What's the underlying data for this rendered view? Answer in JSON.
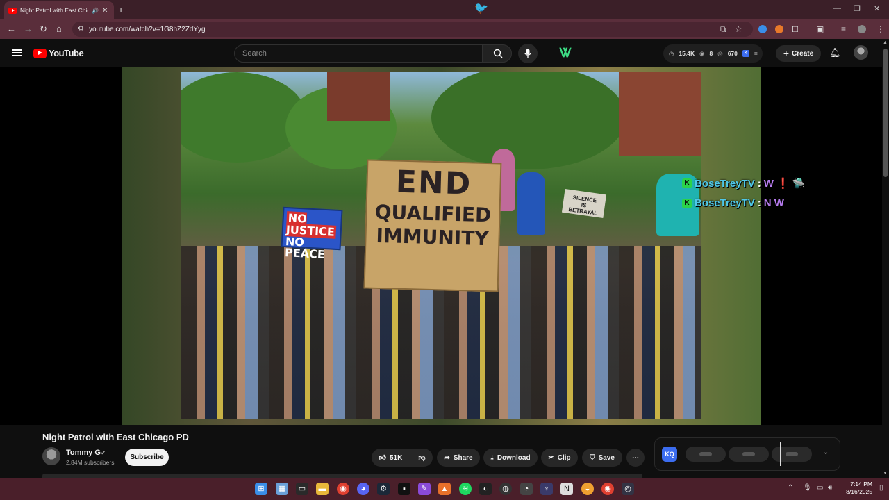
{
  "browser": {
    "tab_title": "Night Patrol with East Chicag",
    "url": "youtube.com/watch?v=1G8hZ2ZdYyg",
    "new_tab_glyph": "+",
    "tab_close_glyph": "✕",
    "audio_glyph": "🔊"
  },
  "youtube": {
    "logo_text": "YouTube",
    "search_placeholder": "Search",
    "create_label": "Create",
    "stats": {
      "views": "15.4K",
      "watching": "8",
      "viewers": "670"
    }
  },
  "video": {
    "sign_big": [
      "END",
      "QUALIFIED",
      "IMMUNITY"
    ],
    "sign_blue": [
      "NO JUSTICE",
      "NO PEACE"
    ],
    "sign_small": [
      "SILENCE",
      "IS",
      "BETRAYAL"
    ]
  },
  "chat": [
    {
      "badge": "K",
      "name": "BoseTreyTV",
      "colon": ":",
      "emotes": "W ❗ 🛸"
    },
    {
      "badge": "K",
      "name": "BoseTreyTV",
      "colon": ":",
      "emotes": "N W"
    }
  ],
  "info": {
    "title": "Night Patrol with East Chicago PD",
    "channel": "Tommy G",
    "subscribers": "2.84M subscribers",
    "subscribe_label": "Subscribe",
    "likes": "51K",
    "share_label": "Share",
    "download_label": "Download",
    "clip_label": "Clip",
    "save_label": "Save"
  },
  "extension": {
    "badge": "KQ"
  },
  "clock": {
    "time": "7:14 PM",
    "date": "8/16/2025"
  },
  "icons": [
    "search-icon",
    "mic-icon",
    "bell-icon",
    "like-icon",
    "dislike-icon",
    "share-icon",
    "download-icon",
    "clip-icon",
    "save-icon",
    "more-icon"
  ]
}
